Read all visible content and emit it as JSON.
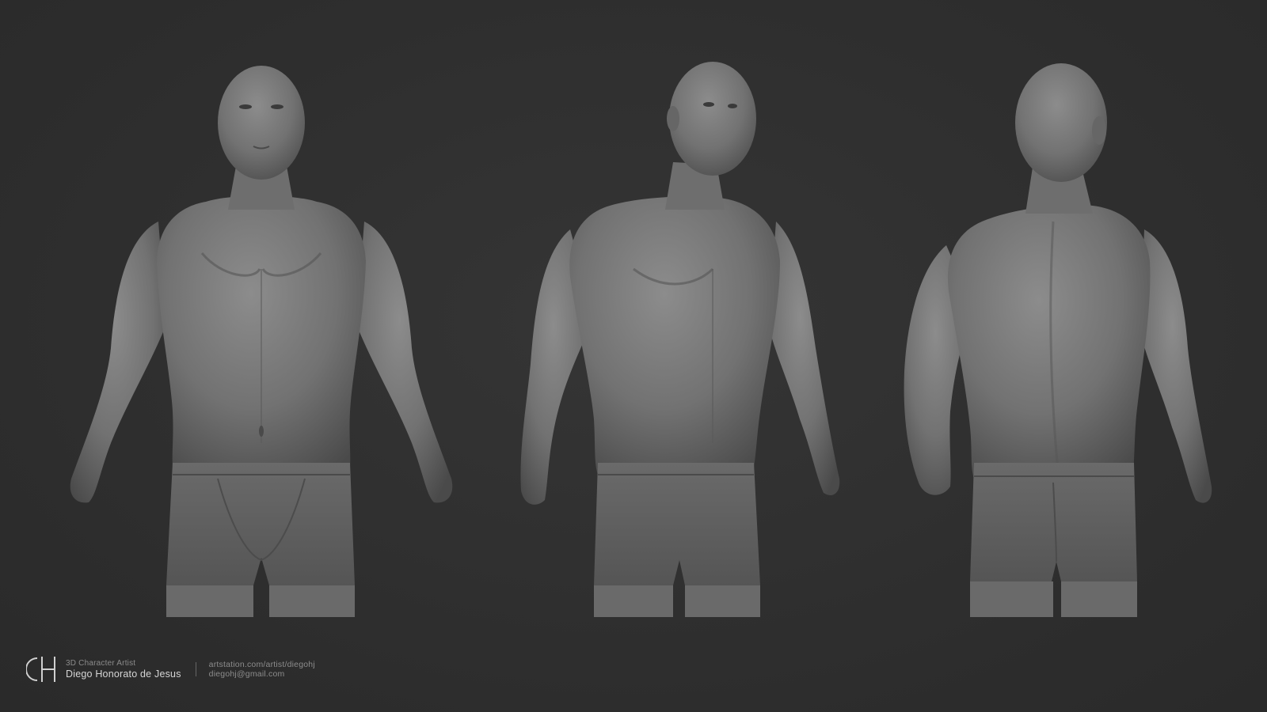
{
  "footer": {
    "logo": "dh-monogram-logo",
    "role": "3D Character Artist",
    "name": "Diego Honorato de Jesus",
    "portfolio": "artstation.com/artist/diegohj",
    "email": "diegohj@gmail.com"
  },
  "colors": {
    "background": "#2f2f2f",
    "sculpt": "#7a7a7a",
    "sculpt_shadow": "#4f4f4f",
    "text_primary": "#d6d6d6",
    "text_secondary": "#8c8c8c"
  },
  "views": [
    "front",
    "three-quarter",
    "back"
  ]
}
